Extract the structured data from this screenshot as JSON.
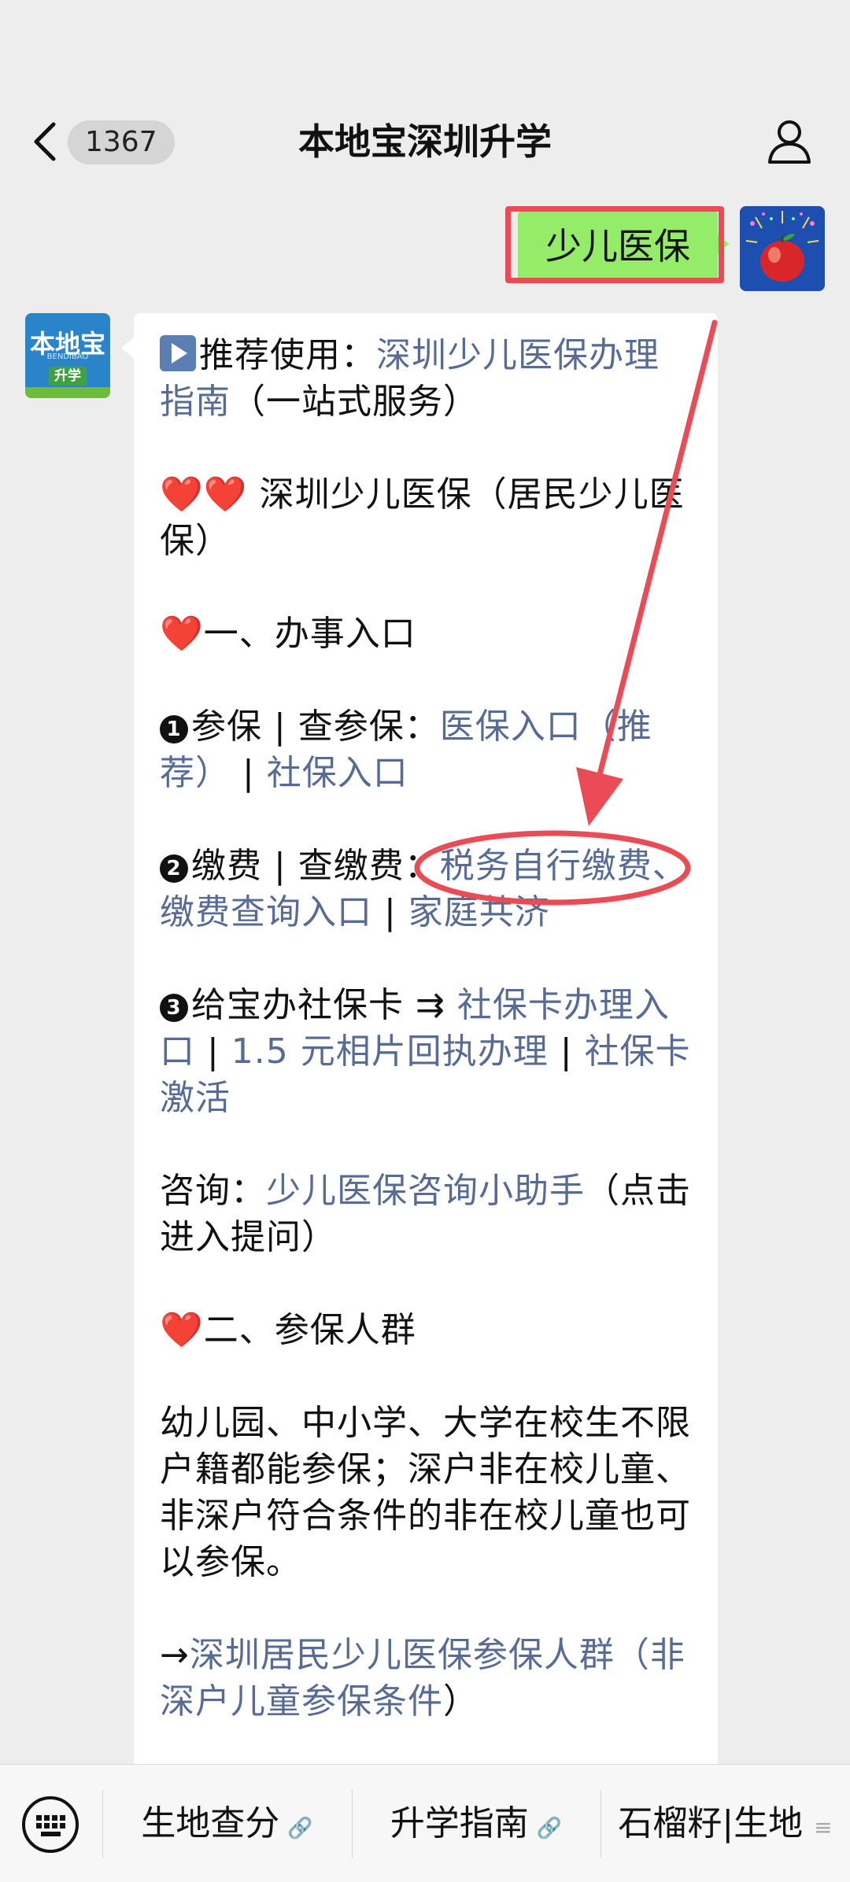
{
  "header": {
    "unread_count": "1367",
    "title": "本地宝深圳升学"
  },
  "sent_message": {
    "text": "少儿医保"
  },
  "avatars": {
    "bot_logo_top": "本地宝",
    "bot_logo_sub": "BENDIBAO",
    "bot_logo_bar": "升学"
  },
  "message": {
    "p1_prefix": "推荐使用：",
    "p1_link": "深圳少儿医保办理指南",
    "p1_suffix": "（一站式服务）",
    "p2_hearts": "❤️❤️",
    "p2_text": " 深圳少儿医保（居民少儿医保）",
    "p3_heart": "❤️",
    "p3_text": "一、办事入口",
    "p4_num": "1",
    "p4_label": "参保 | 查参保：",
    "p4_link1": "医保入口（推荐）",
    "p4_sep": " | ",
    "p4_link2": "社保入口",
    "p5_num": "2",
    "p5_label": "缴费 | 查缴费：",
    "p5_link1": "税务自行缴费、缴费查询入口",
    "p5_sep": " | ",
    "p5_link2": "家庭共济",
    "p6_num": "3",
    "p6_label": "给宝办社保卡 ⇉ ",
    "p6_link1": "社保卡办理入口",
    "p6_sep1": " | ",
    "p6_link2": "1.5 元相片回执办理",
    "p6_sep2": " | ",
    "p6_link3": "社保卡激活",
    "p7_label": "咨询：",
    "p7_link": "少儿医保咨询小助手",
    "p7_suffix": "（点击进入提问）",
    "p8_heart": "❤️",
    "p8_text": "二、参保人群",
    "p9_text": "幼儿园、中小学、大学在校生不限户籍都能参保；深户非在校儿童、非深户符合条件的非在校儿童也可以参保。",
    "p10_arrow": "→",
    "p10_link1": "深圳居民少儿医保参保人群",
    "p10_link2": "（非深户儿童参保条件",
    "p10_suffix": "）"
  },
  "menu": {
    "item1": "生地查分",
    "item2": "升学指南",
    "item3": "石榴籽|生地"
  },
  "colors": {
    "link": "#576b95",
    "sent_bubble": "#95ec69",
    "annotation": "#ea4b55"
  }
}
